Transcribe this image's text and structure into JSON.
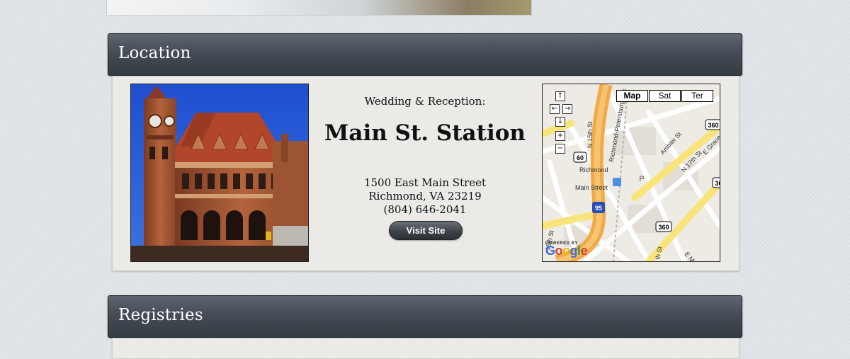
{
  "location": {
    "title": "Location",
    "event_label": "Wedding & Reception:",
    "venue_name": "Main St. Station",
    "address_line1": "1500 East Main Street",
    "address_line2": "Richmond, VA 23219",
    "phone": "(804) 646-2041",
    "visit_button": "Visit Site",
    "map": {
      "types": [
        "Map",
        "Sat",
        "Ter"
      ],
      "active_type": "Map",
      "nav_icons": [
        "arrow-up-icon",
        "arrow-left-icon",
        "arrow-right-icon",
        "arrow-down-icon",
        "zoom-in-icon",
        "zoom-out-icon"
      ],
      "street_labels": [
        "N 15th St",
        "Richmond-Petersburg Tpk",
        "Ambler St",
        "N 17th St",
        "E Grace",
        "Richmond Main Street",
        "E Main St",
        "15th St",
        "th St"
      ],
      "shields": [
        "60",
        "95",
        "360",
        "360",
        "360"
      ],
      "poi_label": "P",
      "powered_by": "POWERED BY",
      "logo": "Google"
    }
  },
  "registries": {
    "title": "Registries"
  }
}
